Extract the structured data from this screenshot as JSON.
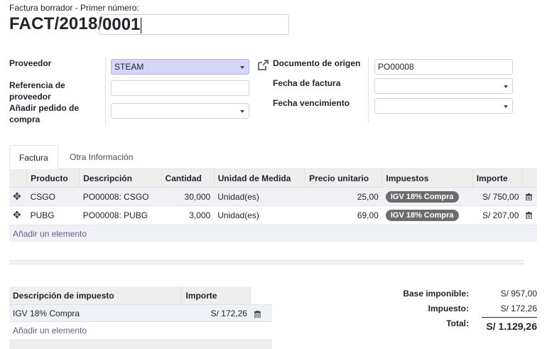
{
  "header": {
    "subtitle": "Factura borrador - Primer número:",
    "prefix": "FACT/2018/",
    "number_value": "0001"
  },
  "left_fields": {
    "proveedor_label": "Proveedor",
    "proveedor_value": "STEAM",
    "referencia_label_1": "Referencia de",
    "referencia_label_2": "proveedor",
    "referencia_value": "",
    "anadir_label_1": "Añadir pedido de",
    "anadir_label_2": "compra",
    "anadir_value": ""
  },
  "right_fields": {
    "documento_label": "Documento de origen",
    "documento_value": "PO00008",
    "fecha_factura_label": "Fecha de factura",
    "fecha_factura_value": "",
    "fecha_venc_label": "Fecha vencimiento",
    "fecha_venc_value": ""
  },
  "tabs": [
    {
      "label": "Factura",
      "active": true
    },
    {
      "label": "Otra Información",
      "active": false
    }
  ],
  "lines": {
    "headers": {
      "producto": "Producto",
      "descripcion": "Descripción",
      "cantidad": "Cantidad",
      "unidad": "Unidad de Medida",
      "precio": "Precio unitario",
      "impuestos": "Impuestos",
      "importe": "Importe"
    },
    "rows": [
      {
        "producto": "CSGO",
        "descripcion": "PO00008: CSGO",
        "cantidad": "30,000",
        "unidad": "Unidad(es)",
        "precio": "25,00",
        "impuesto": "IGV 18% Compra",
        "importe": "S/ 750,00"
      },
      {
        "producto": "PUBG",
        "descripcion": "PO00008: PUBG",
        "cantidad": "3,000",
        "unidad": "Unidad(es)",
        "precio": "69,00",
        "impuesto": "IGV 18% Compra",
        "importe": "S/ 207,00"
      }
    ],
    "add_label": "Añadir un elemento"
  },
  "taxes": {
    "headers": {
      "descripcion": "Descripción de impuesto",
      "importe": "Importe"
    },
    "rows": [
      {
        "descripcion": "IGV 18% Compra",
        "importe": "S/ 172,26"
      }
    ],
    "add_label": "Añadir un elemento"
  },
  "totals": {
    "base_label": "Base imponible:",
    "base_value": "S/ 957,00",
    "impuesto_label": "Impuesto:",
    "impuesto_value": "S/ 172,26",
    "total_label": "Total:",
    "total_value": "S/ 1.129,26"
  },
  "colors": {
    "highlight_field": "#d5d5f7",
    "link": "#6a5a8c",
    "badge": "#6c6c6c",
    "header_bg": "#eeeeee"
  }
}
